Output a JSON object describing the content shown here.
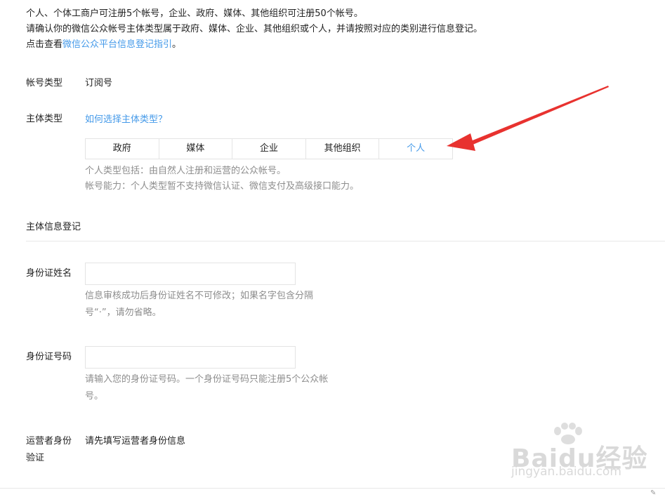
{
  "intro": {
    "line1": "个人、个体工商户可注册5个帐号，企业、政府、媒体、其他组织可注册50个帐号。",
    "line2": "请确认你的微信公众帐号主体类型属于政府、媒体、企业、其他组织或个人，并请按照对应的类别进行信息登记。",
    "line3_prefix": "点击查看",
    "line3_link": "微信公众平台信息登记指引",
    "line3_suffix": "。"
  },
  "account_type": {
    "label": "帐号类型",
    "value": "订阅号"
  },
  "subject_type": {
    "label": "主体类型",
    "help_link": "如何选择主体类型？",
    "options": [
      "政府",
      "媒体",
      "企业",
      "其他组织",
      "个人"
    ],
    "selected": "个人",
    "desc1": "个人类型包括：由自然人注册和运营的公众帐号。",
    "desc2": "帐号能力：个人类型暂不支持微信认证、微信支付及高级接口能力。"
  },
  "section": {
    "title": "主体信息登记"
  },
  "id_name": {
    "label": "身份证姓名",
    "value": "",
    "placeholder": "",
    "hint": "信息审核成功后身份证姓名不可修改；如果名字包含分隔号“·”，请勿省略。"
  },
  "id_number": {
    "label": "身份证号码",
    "value": "",
    "placeholder": "",
    "hint": "请输入您的身份证号码。一个身份证号码只能注册5个公众帐号。"
  },
  "operator": {
    "label": "运营者身份验证",
    "value": "请先填写运营者身份信息"
  },
  "annotation": {
    "arrow_color": "#e8322f"
  },
  "watermark": {
    "brand": "Baidu经验",
    "sub": "jingyan.baidu.com"
  },
  "colors": {
    "link": "#459ae9",
    "hint": "#8d8d8d",
    "border": "#e4e4e4"
  }
}
